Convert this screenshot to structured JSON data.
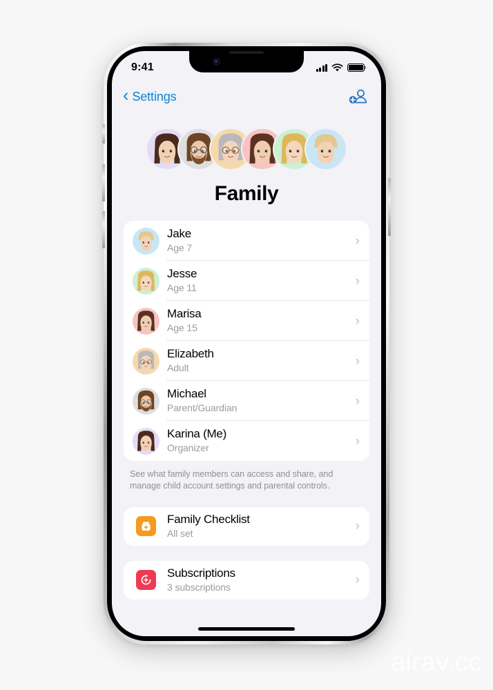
{
  "watermark": "airav.cc",
  "status_bar": {
    "time": "9:41",
    "cellular_icon": "signal-bars-icon",
    "wifi_icon": "wifi-icon",
    "battery_icon": "battery-full-icon"
  },
  "nav_bar": {
    "back_label": "Settings",
    "back_icon": "chevron-left-icon",
    "add_person_icon": "add-person-icon",
    "accent_color": "#0a84d8"
  },
  "header": {
    "title": "Family",
    "avatar_cluster": [
      {
        "name": "Karina",
        "bg": "#e4dcf5"
      },
      {
        "name": "Michael",
        "bg": "#dedede"
      },
      {
        "name": "Elizabeth",
        "bg": "#f6d9ab"
      },
      {
        "name": "Marisa",
        "bg": "#f7c3c3"
      },
      {
        "name": "Jesse",
        "bg": "#cdefd2"
      },
      {
        "name": "Jake",
        "bg": "#c9e6f5"
      }
    ]
  },
  "members": [
    {
      "name": "Jake",
      "role": "Age 7",
      "avatar_bg": "#c9e6f5",
      "hair": "#e3c78f",
      "skin": "#f2d2b4",
      "style": "child"
    },
    {
      "name": "Jesse",
      "role": "Age 11",
      "avatar_bg": "#cdefd2",
      "hair": "#ddb85a",
      "skin": "#f5d7bb",
      "style": "long"
    },
    {
      "name": "Marisa",
      "role": "Age 15",
      "avatar_bg": "#f7c3c3",
      "hair": "#5b3220",
      "skin": "#f0cdb0",
      "style": "long"
    },
    {
      "name": "Elizabeth",
      "role": "Adult",
      "avatar_bg": "#f6d9ab",
      "hair": "#b9b9bb",
      "skin": "#f3d5bb",
      "style": "glasses"
    },
    {
      "name": "Michael",
      "role": "Parent/Guardian",
      "avatar_bg": "#dedede",
      "hair": "#6d4526",
      "skin": "#edc9a8",
      "style": "beard"
    },
    {
      "name": "Karina (Me)",
      "role": "Organizer",
      "avatar_bg": "#e4dcf5",
      "hair": "#4a2a1c",
      "skin": "#f1d0b4",
      "style": "long"
    }
  ],
  "footer_note": "See what family members can access and share, and manage child account settings and parental controls.",
  "checklist": {
    "title": "Family Checklist",
    "subtitle": "All set",
    "icon": "family-checklist-icon",
    "icon_color": "#f59a1f",
    "chevron_icon": "chevron-right-icon"
  },
  "subscriptions": {
    "title": "Subscriptions",
    "subtitle": "3 subscriptions",
    "icon": "subscriptions-icon",
    "icon_color": "#ef3a53",
    "chevron_icon": "chevron-right-icon"
  },
  "chevron_glyph": "›",
  "home_indicator": "home-indicator"
}
